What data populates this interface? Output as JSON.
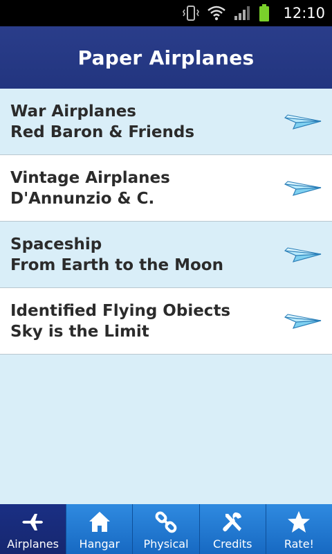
{
  "status": {
    "time": "12:10"
  },
  "header": {
    "title": "Paper Airplanes"
  },
  "list": [
    {
      "title": "War Airplanes",
      "subtitle": "Red Baron & Friends"
    },
    {
      "title": "Vintage Airplanes",
      "subtitle": "D'Annunzio & C."
    },
    {
      "title": "Spaceship",
      "subtitle": "From Earth to the Moon"
    },
    {
      "title": "Identified Flying Obiects",
      "subtitle": "Sky is the Limit"
    }
  ],
  "tabs": [
    {
      "label": "Airplanes",
      "icon": "airplane-icon",
      "active": true
    },
    {
      "label": "Hangar",
      "icon": "home-icon"
    },
    {
      "label": "Physical",
      "icon": "link-icon"
    },
    {
      "label": "Credits",
      "icon": "tools-icon"
    },
    {
      "label": "Rate!",
      "icon": "star-icon"
    }
  ],
  "colors": {
    "titlebar": "#22357f",
    "list_alt": "#d9eef8",
    "list_white": "#ffffff",
    "tab": "#1b6fc9",
    "tab_active": "#1a2f84"
  }
}
